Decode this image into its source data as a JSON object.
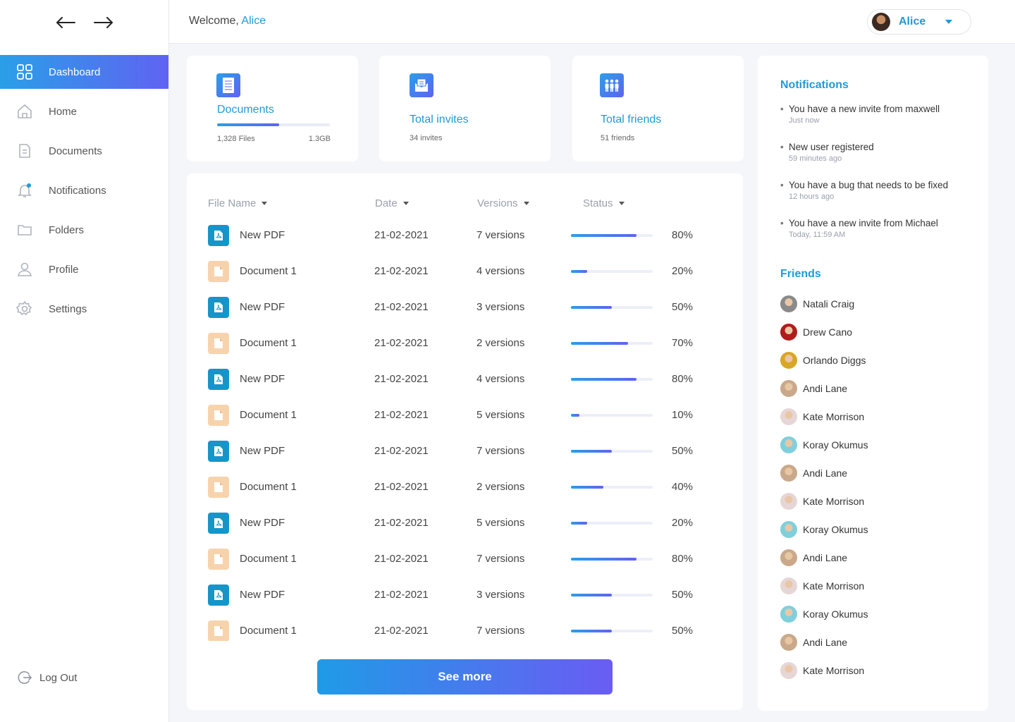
{
  "sidebar": {
    "menu": [
      {
        "label": "Dashboard",
        "icon": "dashboard-icon",
        "active": true
      },
      {
        "label": "Home",
        "icon": "home-icon"
      },
      {
        "label": "Documents",
        "icon": "documents-icon"
      },
      {
        "label": "Notifications",
        "icon": "bell-icon"
      },
      {
        "label": "Folders",
        "icon": "folder-icon"
      },
      {
        "label": "Profile",
        "icon": "profile-icon"
      },
      {
        "label": "Settings",
        "icon": "settings-icon"
      }
    ],
    "logout_label": "Log Out"
  },
  "header": {
    "welcome_prefix": "Welcome,",
    "user_name": "Alice",
    "user_menu_name": "Alice"
  },
  "stats": {
    "documents": {
      "title": "Documents",
      "files": "1,328 Files",
      "size": "1.3GB",
      "progress": 0.55
    },
    "invites": {
      "title": "Total invites",
      "sub": "34 invites"
    },
    "friends": {
      "title": "Total friends",
      "sub": "51 friends"
    }
  },
  "table": {
    "headers": {
      "name": "File Name",
      "date": "Date",
      "versions": "Versions",
      "status": "Status"
    },
    "rows": [
      {
        "type": "pdf",
        "name": "New PDF",
        "date": "21-02-2021",
        "versions": "7 versions",
        "status": "80%",
        "progress": 0.8
      },
      {
        "type": "doc",
        "name": "Document 1",
        "date": "21-02-2021",
        "versions": "4 versions",
        "status": "20%",
        "progress": 0.2
      },
      {
        "type": "pdf",
        "name": "New PDF",
        "date": "21-02-2021",
        "versions": "3 versions",
        "status": "50%",
        "progress": 0.5
      },
      {
        "type": "doc",
        "name": "Document 1",
        "date": "21-02-2021",
        "versions": "2 versions",
        "status": "70%",
        "progress": 0.7
      },
      {
        "type": "pdf",
        "name": "New PDF",
        "date": "21-02-2021",
        "versions": "4 versions",
        "status": "80%",
        "progress": 0.8
      },
      {
        "type": "doc",
        "name": "Document 1",
        "date": "21-02-2021",
        "versions": "5 versions",
        "status": "10%",
        "progress": 0.1
      },
      {
        "type": "pdf",
        "name": "New PDF",
        "date": "21-02-2021",
        "versions": "7 versions",
        "status": "50%",
        "progress": 0.5
      },
      {
        "type": "doc",
        "name": "Document 1",
        "date": "21-02-2021",
        "versions": "2 versions",
        "status": "40%",
        "progress": 0.4
      },
      {
        "type": "pdf",
        "name": "New PDF",
        "date": "21-02-2021",
        "versions": "5 versions",
        "status": "20%",
        "progress": 0.2
      },
      {
        "type": "doc",
        "name": "Document 1",
        "date": "21-02-2021",
        "versions": "7 versions",
        "status": "80%",
        "progress": 0.8
      },
      {
        "type": "pdf",
        "name": "New PDF",
        "date": "21-02-2021",
        "versions": "3 versions",
        "status": "50%",
        "progress": 0.5
      },
      {
        "type": "doc",
        "name": "Document 1",
        "date": "21-02-2021",
        "versions": "7 versions",
        "status": "50%",
        "progress": 0.5
      }
    ],
    "see_more_label": "See more"
  },
  "notifications": {
    "title": "Notifications",
    "items": [
      {
        "text": "You have a new invite from maxwell",
        "time": "Just now"
      },
      {
        "text": "New user registered",
        "time": "59 minutes ago"
      },
      {
        "text": "You have a bug that needs to be fixed",
        "time": "12 hours ago"
      },
      {
        "text": "You have a new invite from Michael",
        "time": "Today, 11:59 AM"
      }
    ]
  },
  "friends": {
    "title": "Friends",
    "items": [
      {
        "name": "Natali Craig",
        "color": "#8a8a8a"
      },
      {
        "name": "Drew Cano",
        "color": "#b01c1c"
      },
      {
        "name": "Orlando Diggs",
        "color": "#d9a627"
      },
      {
        "name": "Andi Lane",
        "color": "#c9a98a"
      },
      {
        "name": "Kate Morrison",
        "color": "#e7d6d6"
      },
      {
        "name": "Koray Okumus",
        "color": "#7fd0dc"
      },
      {
        "name": "Andi Lane",
        "color": "#c9a98a"
      },
      {
        "name": "Kate Morrison",
        "color": "#e7d6d6"
      },
      {
        "name": "Koray Okumus",
        "color": "#7fd0dc"
      },
      {
        "name": "Andi Lane",
        "color": "#c9a98a"
      },
      {
        "name": "Kate Morrison",
        "color": "#e7d6d6"
      },
      {
        "name": "Koray Okumus",
        "color": "#7fd0dc"
      },
      {
        "name": "Andi Lane",
        "color": "#c9a98a"
      },
      {
        "name": "Kate Morrison",
        "color": "#e7d6d6"
      }
    ]
  },
  "colors": {
    "accent": "#1f9bd6",
    "gradient_start": "#2a9fe8",
    "gradient_end": "#5f63f2",
    "pdf_icon": "#1595c9",
    "doc_icon": "#f7d3ad"
  }
}
